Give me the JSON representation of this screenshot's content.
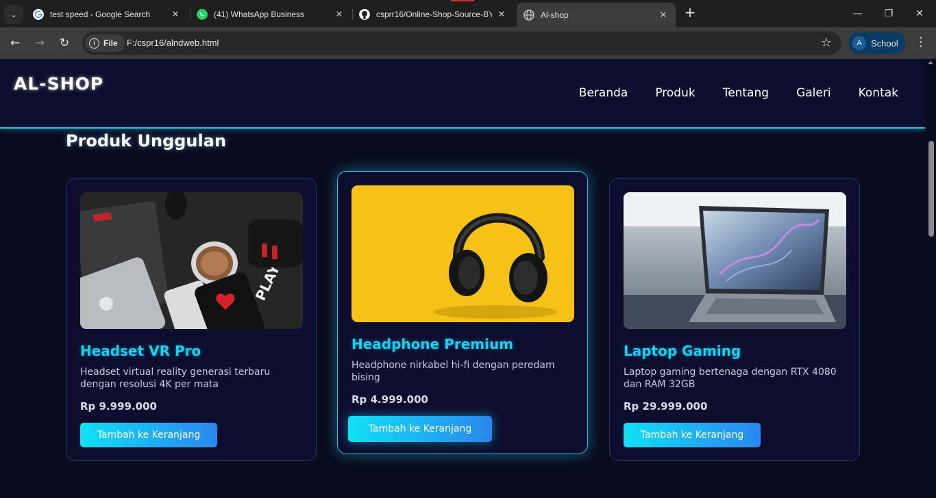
{
  "browser": {
    "tabs": [
      {
        "title": "test speed - Google Search"
      },
      {
        "title": "(41) WhatsApp Business"
      },
      {
        "title": "csprr16/Online-Shop-Source-BY"
      },
      {
        "title": "Al-shop"
      }
    ],
    "file_label": "File",
    "url": "F:/cspr16/alndweb.html",
    "profile": {
      "initial": "A",
      "name": "School"
    }
  },
  "site": {
    "logo": "AL-SHOP",
    "nav": [
      "Beranda",
      "Produk",
      "Tentang",
      "Galeri",
      "Kontak"
    ],
    "section_title": "Produk Unggulan",
    "products": [
      {
        "name": "Headset VR Pro",
        "description": "Headset virtual reality generasi terbaru dengan resolusi 4K per mata",
        "price": "Rp 9.999.000",
        "button": "Tambah ke Keranjang"
      },
      {
        "name": "Headphone Premium",
        "description": "Headphone nirkabel hi-fi dengan peredam bising",
        "price": "Rp 4.999.000",
        "button": "Tambah ke Keranjang"
      },
      {
        "name": "Laptop Gaming",
        "description": "Laptop gaming bertenaga dengan RTX 4080 dan RAM 32GB",
        "price": "Rp 29.999.000",
        "button": "Tambah ke Keranjang"
      }
    ]
  },
  "colors": {
    "accent": "#15d2f0",
    "page_bg": "#0a0b1e",
    "card_bg": "#0d0e2e"
  }
}
